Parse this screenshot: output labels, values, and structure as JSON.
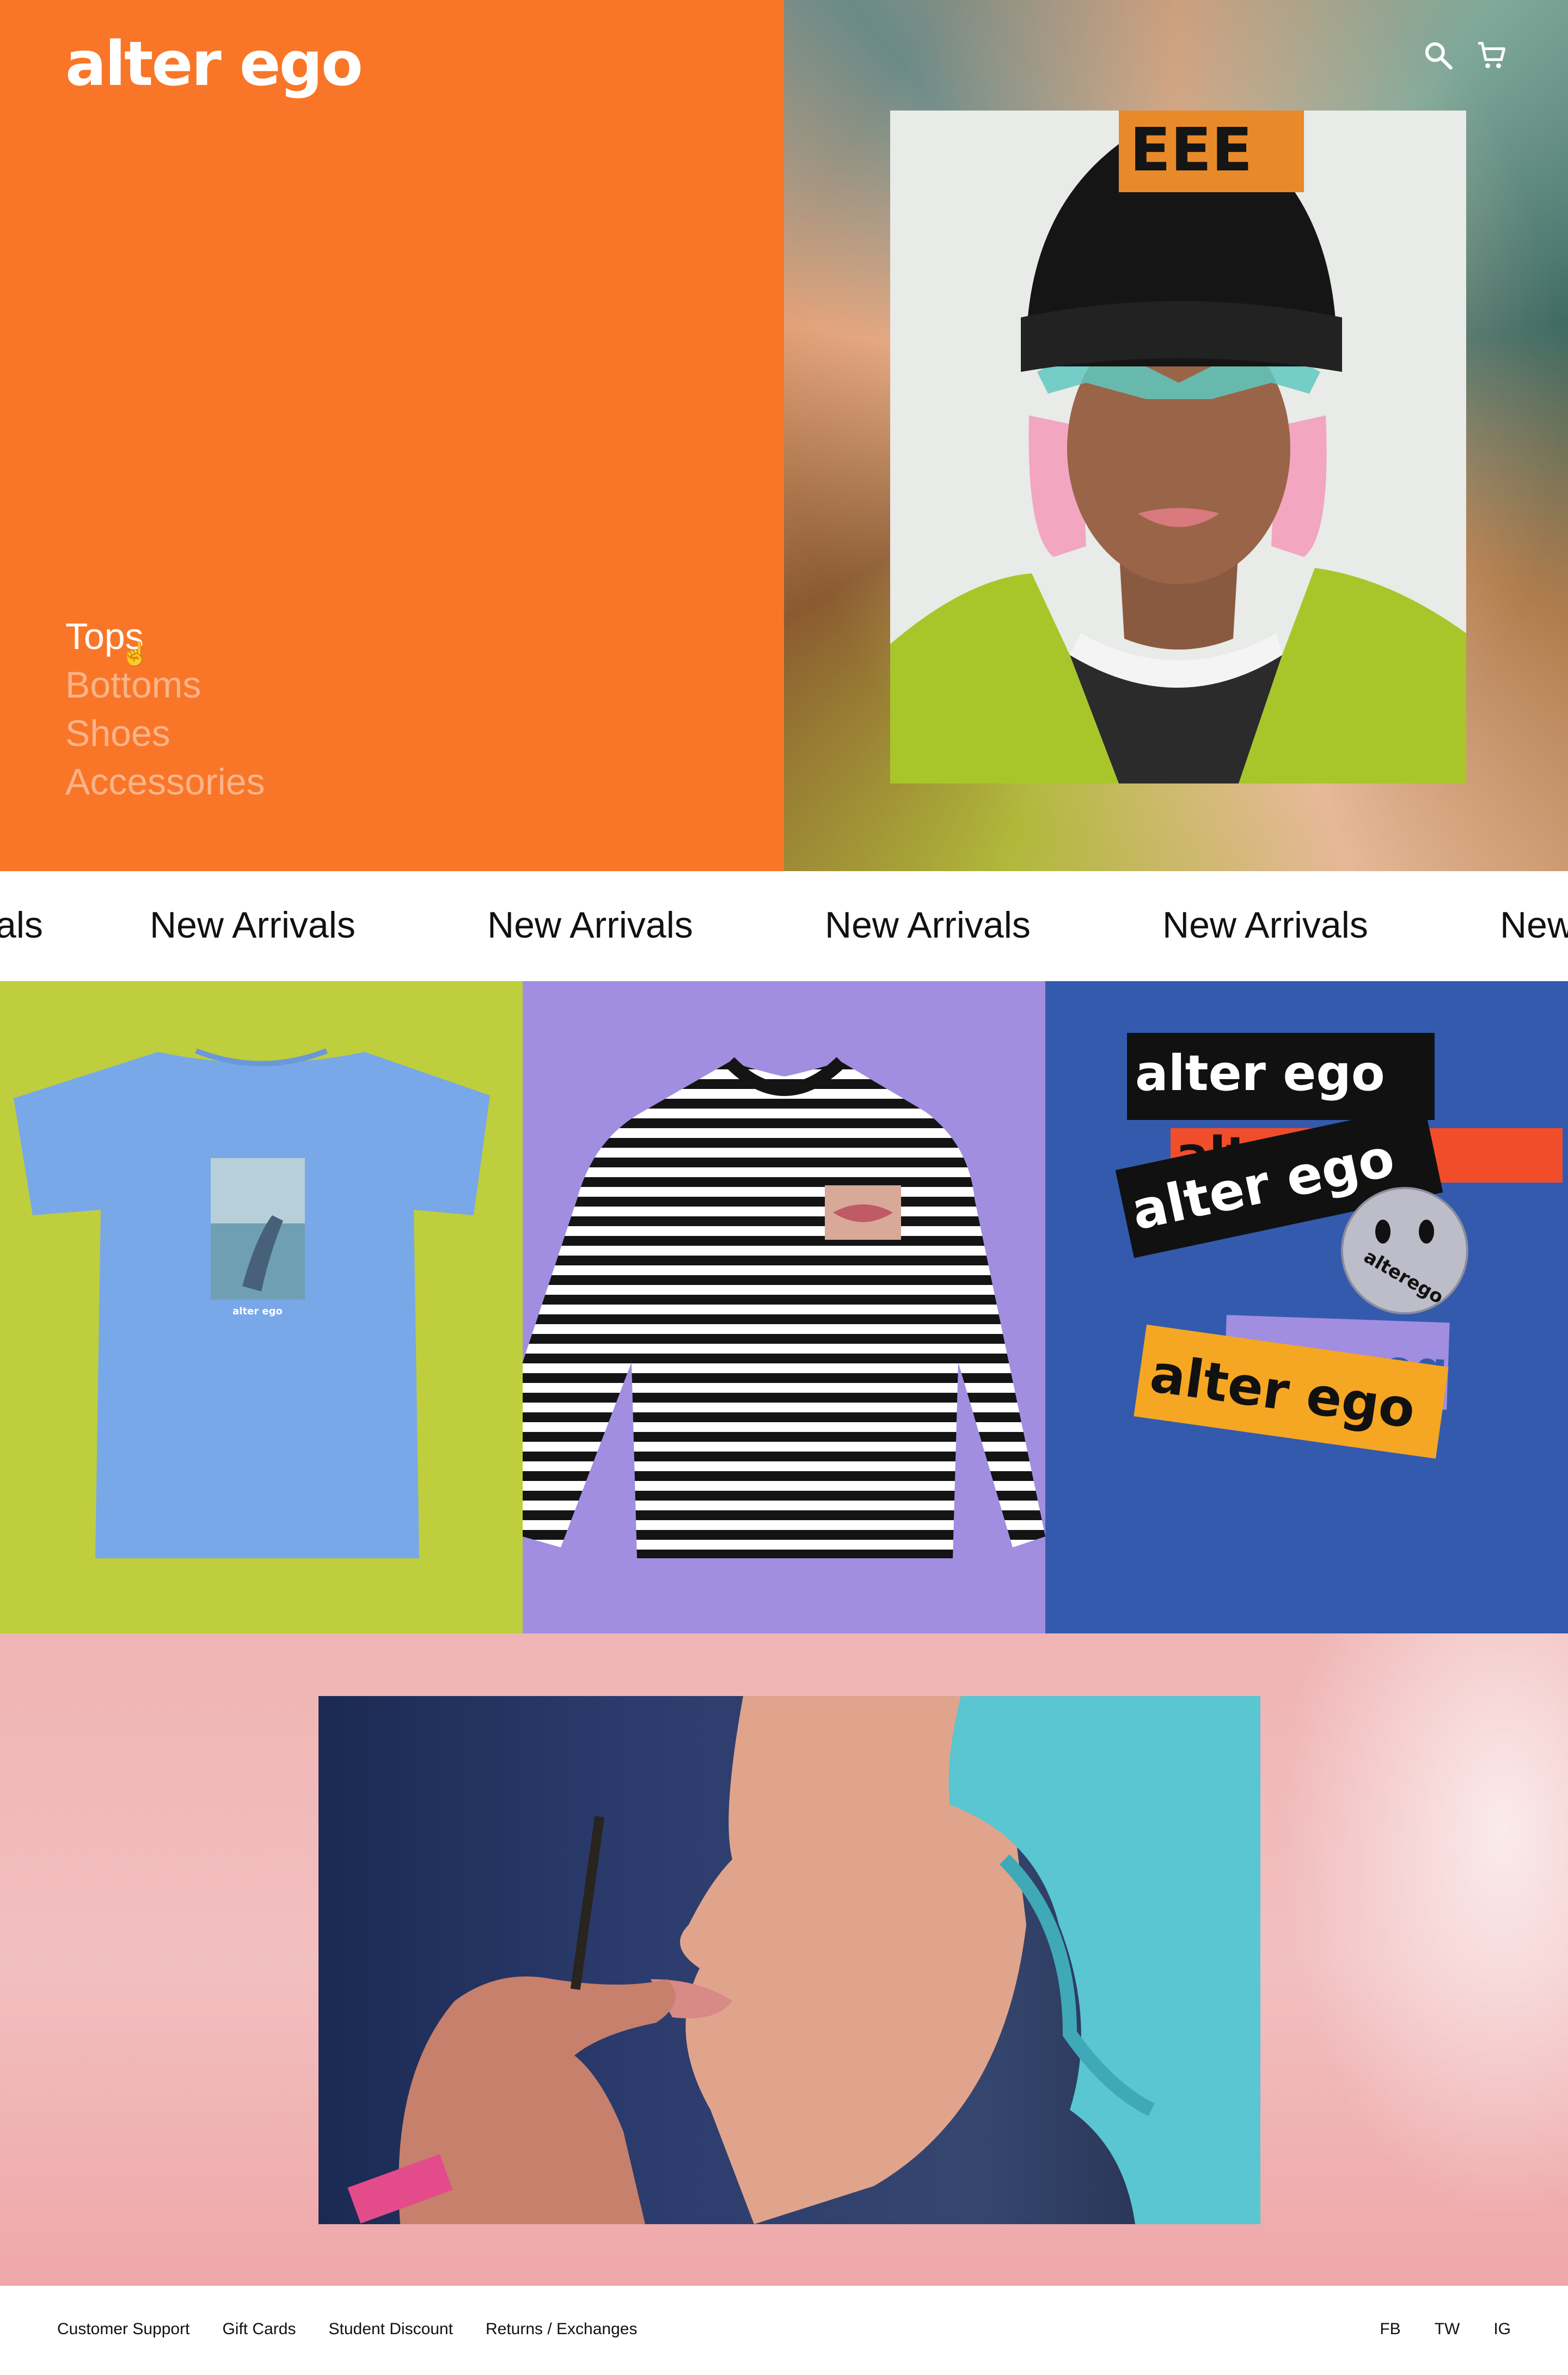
{
  "brand": {
    "logo_text": "alter ego"
  },
  "header": {
    "search_icon": "search-icon",
    "cart_icon": "cart-icon"
  },
  "categories": [
    {
      "label": "Tops",
      "active": true
    },
    {
      "label": "Bottoms",
      "active": false
    },
    {
      "label": "Shoes",
      "active": false
    },
    {
      "label": "Accessories",
      "active": false
    }
  ],
  "marquee": {
    "partial_left": "als",
    "items": [
      "New Arrivals",
      "New Arrivals",
      "New Arrivals",
      "New Arrivals"
    ],
    "partial_right": "New"
  },
  "products": [
    {
      "background": "#bfce3d",
      "tee_print_text": "alter ego"
    },
    {
      "background": "#a18ee0"
    },
    {
      "background": "#345aae",
      "stickers": [
        "alter ego",
        "alter ego",
        "alter ego",
        "alter ego",
        "alter ego"
      ],
      "badge_text": "alterego"
    }
  ],
  "footer": {
    "links": [
      "Customer Support",
      "Gift Cards",
      "Student Discount",
      "Returns / Exchanges"
    ],
    "social": [
      "FB",
      "TW",
      "IG"
    ]
  },
  "colors": {
    "hero_orange": "#f97628",
    "lime": "#bfce3d",
    "lavender": "#a18ee0",
    "royal_blue": "#345aae",
    "pink": "#f0b4b4"
  }
}
